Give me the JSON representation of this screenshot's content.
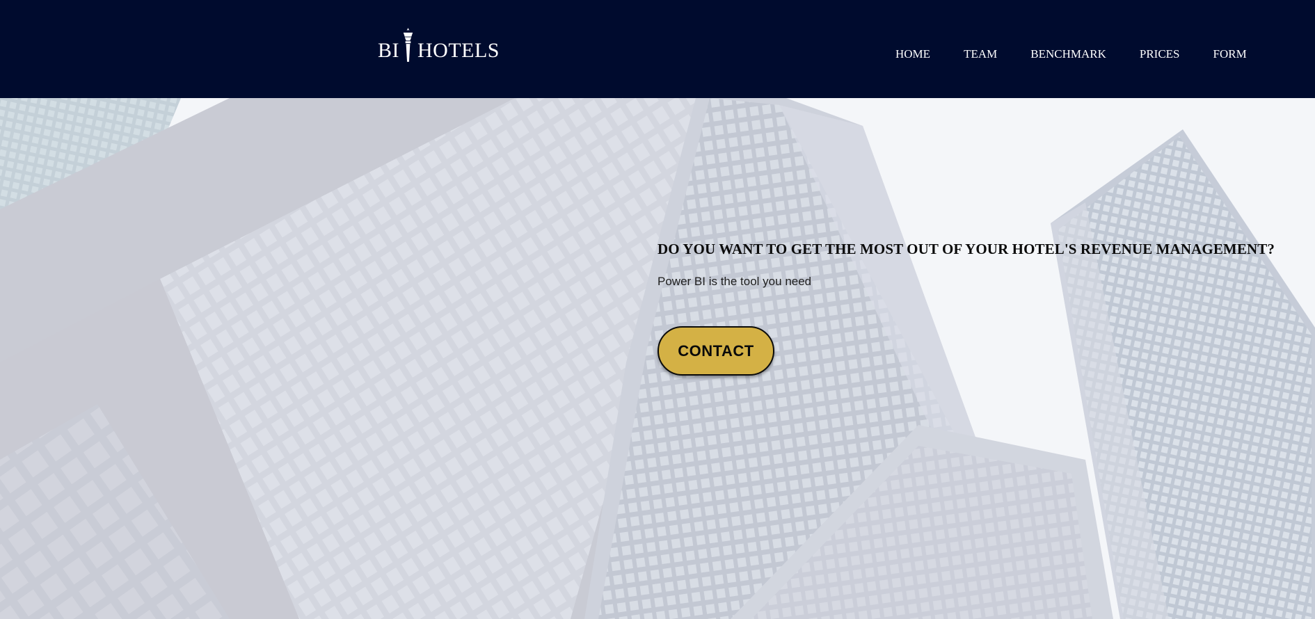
{
  "header": {
    "logo": {
      "left_text": "BI",
      "right_text": "HOTELS",
      "icon": "torch-icon"
    },
    "nav": [
      {
        "label": "HOME"
      },
      {
        "label": "TEAM"
      },
      {
        "label": "BENCHMARK"
      },
      {
        "label": "PRICES"
      },
      {
        "label": "FORM"
      }
    ]
  },
  "hero": {
    "title": "DO YOU WANT TO GET THE MOST OUT OF YOUR HOTEL'S REVENUE MANAGEMENT?",
    "subtitle": "Power BI is the tool you need",
    "cta_label": "CONTACT",
    "background": "skyscrapers-photo"
  },
  "colors": {
    "header_bg": "#000b2e",
    "nav_text": "#ffffff",
    "cta_bg": "#d4b145",
    "cta_border": "#0a0a0a",
    "title_text": "#0b0b0b"
  }
}
